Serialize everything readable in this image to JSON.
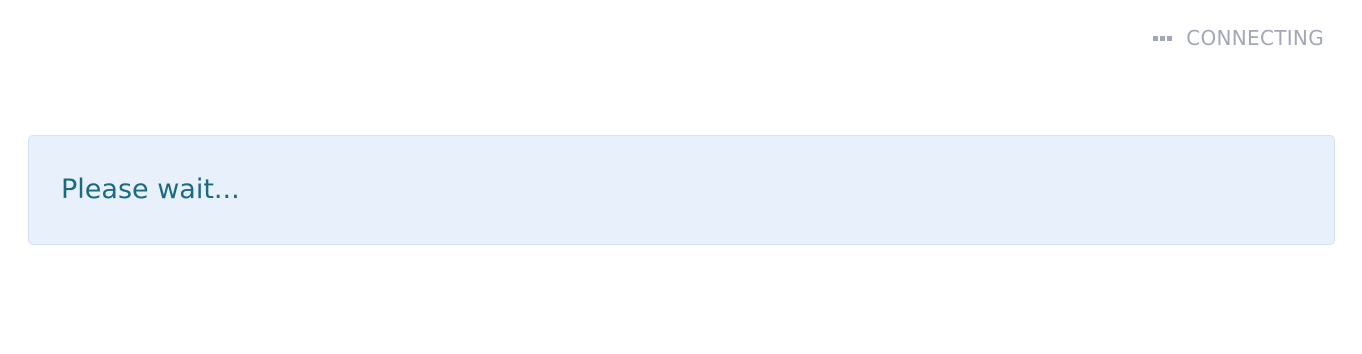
{
  "status": {
    "label": "CONNECTING",
    "icon": "ellipsis-icon",
    "color": "#a3a8b8"
  },
  "alert": {
    "message": "Please wait...",
    "background": "#e8f1fb",
    "text_color": "#1c6a80"
  }
}
